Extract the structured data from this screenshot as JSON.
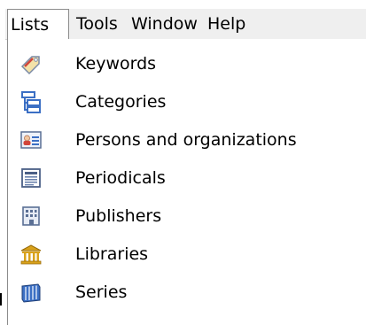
{
  "menubar": {
    "items": [
      {
        "label": "Lists"
      },
      {
        "label": "Tools"
      },
      {
        "label": "Window"
      },
      {
        "label": "Help"
      }
    ]
  },
  "menu": {
    "items": [
      {
        "label": "Keywords",
        "icon": "keyword-tag-icon"
      },
      {
        "label": "Categories",
        "icon": "tree-hierarchy-icon"
      },
      {
        "label": "Persons and organizations",
        "icon": "contact-card-icon"
      },
      {
        "label": "Periodicals",
        "icon": "newspaper-icon"
      },
      {
        "label": "Publishers",
        "icon": "building-icon"
      },
      {
        "label": "Libraries",
        "icon": "library-columns-icon"
      },
      {
        "label": "Series",
        "icon": "book-series-icon"
      }
    ]
  },
  "colors": {
    "menubar_bg": "#efefef",
    "menu_bg": "#ffffff",
    "icon_blue": "#3b6fc4",
    "icon_gold": "#d9a21b",
    "icon_red": "#d2453a"
  }
}
